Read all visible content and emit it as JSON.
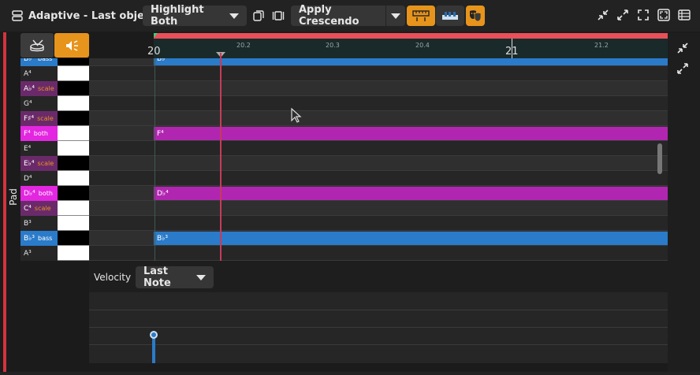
{
  "window": {
    "title": "Adaptive - Last object"
  },
  "toolbar": {
    "highlight_select": "Highlight Both",
    "apply_select": "Apply Crescendo"
  },
  "track": {
    "name": "Pad"
  },
  "ruler": {
    "bar_20": "20",
    "bar_21": "21",
    "ticks": [
      "20.2",
      "20.3",
      "20.4",
      "21.2"
    ]
  },
  "piano_keys": [
    {
      "note": "B♭⁴",
      "tag": "bass"
    },
    {
      "note": "A⁴",
      "tag": ""
    },
    {
      "note": "A♭⁴",
      "tag": "scale"
    },
    {
      "note": "G⁴",
      "tag": ""
    },
    {
      "note": "F♯⁴",
      "tag": "scale"
    },
    {
      "note": "F⁴",
      "tag": "both"
    },
    {
      "note": "E⁴",
      "tag": ""
    },
    {
      "note": "E♭⁴",
      "tag": "scale"
    },
    {
      "note": "D⁴",
      "tag": ""
    },
    {
      "note": "D♭⁴",
      "tag": "both"
    },
    {
      "note": "C⁴",
      "tag": "scale"
    },
    {
      "note": "B³",
      "tag": ""
    },
    {
      "note": "B♭³",
      "tag": "bass"
    },
    {
      "note": "A³",
      "tag": ""
    }
  ],
  "notes": [
    {
      "label": "B♭⁴"
    },
    {
      "label": "F⁴"
    },
    {
      "label": "D♭⁴"
    },
    {
      "label": "B♭³"
    }
  ],
  "velocity": {
    "label": "Velocity",
    "mode": "Last Note"
  },
  "colors": {
    "accent_orange": "#e7941c",
    "bass_blue": "#2a7bc9",
    "both_magenta": "#b126b0",
    "scale_purple": "#6a2a6a",
    "playhead": "#c83a5a",
    "track_red": "#d3343e"
  }
}
